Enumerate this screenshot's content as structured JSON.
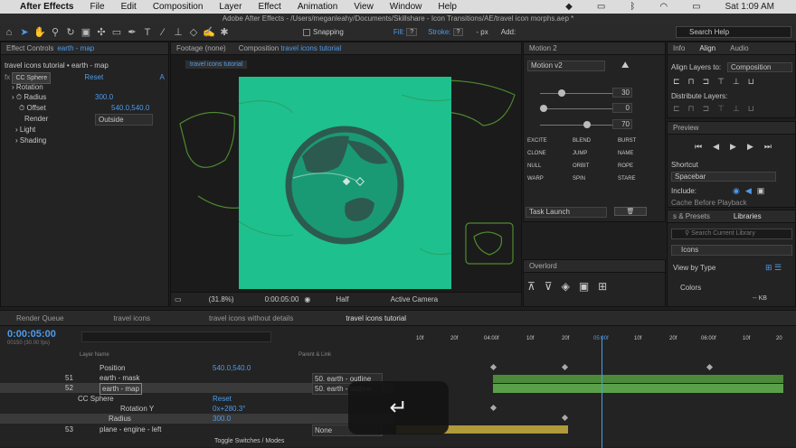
{
  "menubar": {
    "apple": "",
    "app": "After Effects",
    "items": [
      "File",
      "Edit",
      "Composition",
      "Layer",
      "Effect",
      "Animation",
      "View",
      "Window",
      "Help"
    ],
    "datetime": "Sat 1:09 AM"
  },
  "window_title": "Adobe After Effects - /Users/meganleahy/Documents/Skillshare - Icon Transitions/AE/travel icon morphs.aep *",
  "toolbar": {
    "snapping": "Snapping",
    "fill_label": "Fill:",
    "fill_val": "?",
    "stroke_label": "Stroke:",
    "stroke_val": "?",
    "stroke_px": "- px",
    "add_label": "Add:",
    "search": "Search Help"
  },
  "effect_controls": {
    "tab_prefix": "Effect Controls",
    "tab_layer": "earth - map",
    "header": "travel icons tutorial • earth - map",
    "effect": "CC Sphere",
    "reset": "Reset",
    "about": "A",
    "props": [
      {
        "name": "Rotation",
        "value": ""
      },
      {
        "name": "Radius",
        "value": "300.0"
      },
      {
        "name": "Offset",
        "value": "540.0,540.0"
      },
      {
        "name": "Render",
        "value": "Outside"
      },
      {
        "name": "Light",
        "value": ""
      },
      {
        "name": "Shading",
        "value": ""
      }
    ]
  },
  "viewer": {
    "tab_footage": "Footage (none)",
    "tab_comp_prefix": "Composition",
    "tab_comp": "travel icons tutorial",
    "comp_pill": "travel icons tutorial",
    "zoom": "(31.8%)",
    "timecode": "0:00:05:00",
    "quality": "Half",
    "camera": "Active Camera",
    "colors": {
      "green": "#1ec08e",
      "globe": "#2d5a4e",
      "ocean": "#1a9a74"
    }
  },
  "motion": {
    "title": "Motion 2",
    "version": "Motion v2",
    "slider1": "30",
    "slider2": "0",
    "slider3": "70",
    "buttons": [
      "EXCITE",
      "BLEND",
      "BURST",
      "CLONE",
      "JUMP",
      "NAME",
      "NULL",
      "ORBIT",
      "ROPE",
      "WARP",
      "SPIN",
      "STARE"
    ],
    "task": "Task Launch"
  },
  "overlord": {
    "title": "Overlord"
  },
  "align": {
    "tabs": [
      "Info",
      "Align",
      "Audio"
    ],
    "align_to_label": "Align Layers to:",
    "align_to": "Composition",
    "distribute": "Distribute Layers:"
  },
  "preview": {
    "title": "Preview",
    "shortcut_label": "Shortcut",
    "shortcut": "Spacebar",
    "include": "Include:",
    "cache": "Cache Before Playback"
  },
  "libraries": {
    "tab_presets": "s & Presets",
    "tab_lib": "Libraries",
    "search": "Search Current Library",
    "lib": "Icons",
    "view": "View by Type",
    "colors": "Colors",
    "kb": "-- KB"
  },
  "timeline": {
    "tabs": [
      "Render Queue",
      "travel icons",
      "travel icons without details",
      "travel icons tutorial"
    ],
    "timecode": "0:00:05:00",
    "frames": "00150 (30.00 fps)",
    "col_layer": "Layer Name",
    "col_parent": "Parent & Link",
    "ruler": [
      "10f",
      "20f",
      "04:00f",
      "10f",
      "20f",
      "05:00f",
      "10f",
      "20f",
      "06:00f",
      "10f",
      "20"
    ],
    "toggle": "Toggle Switches / Modes",
    "layers": [
      {
        "num": "",
        "name": "Position",
        "value": "540.0,540.0",
        "parent": ""
      },
      {
        "num": "51",
        "name": "earth - mask",
        "value": "",
        "parent": "50. earth - outline"
      },
      {
        "num": "52",
        "name": "earth - map",
        "value": "",
        "parent": "50. earth - outline"
      },
      {
        "num": "",
        "name": "CC Sphere",
        "value": "Reset",
        "parent": ""
      },
      {
        "num": "",
        "name": "Rotation Y",
        "value": "0x+280.3°",
        "parent": ""
      },
      {
        "num": "",
        "name": "Radius",
        "value": "300.0",
        "parent": ""
      },
      {
        "num": "53",
        "name": "plane - engine - left",
        "value": "",
        "parent": "None"
      }
    ]
  },
  "overlay": {
    "icon": "return-arrow"
  }
}
